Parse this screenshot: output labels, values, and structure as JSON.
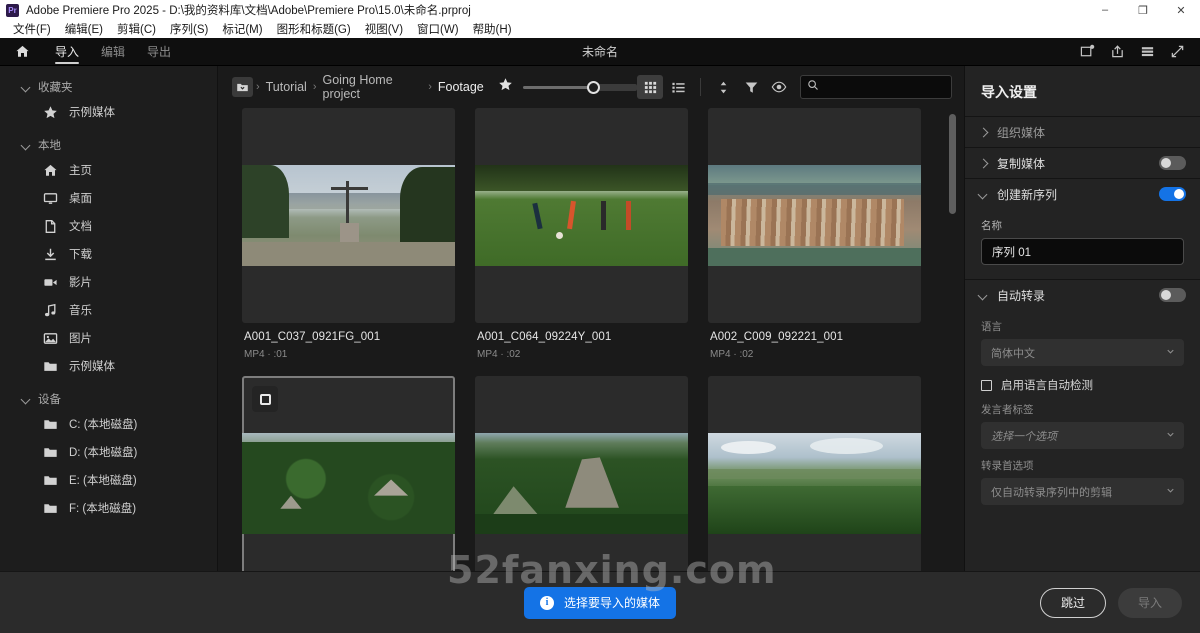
{
  "window": {
    "title": "Adobe Premiere Pro 2025 - D:\\我的资料库\\文档\\Adobe\\Premiere Pro\\15.0\\未命名.prproj",
    "logo": "Pr",
    "minimize": "–",
    "maximize": "❐",
    "close": "✕"
  },
  "menu": {
    "items": [
      {
        "label": "文件(F)"
      },
      {
        "label": "编辑(E)"
      },
      {
        "label": "剪辑(C)"
      },
      {
        "label": "序列(S)"
      },
      {
        "label": "标记(M)"
      },
      {
        "label": "图形和标题(G)"
      },
      {
        "label": "视图(V)"
      },
      {
        "label": "窗口(W)"
      },
      {
        "label": "帮助(H)"
      }
    ]
  },
  "appbar": {
    "home_icon": "home-icon",
    "tabs": [
      {
        "label": "导入",
        "active": true
      },
      {
        "label": "编辑",
        "active": false
      },
      {
        "label": "导出",
        "active": false
      }
    ],
    "doc_title": "未命名",
    "right_icons": [
      {
        "name": "new-project-icon"
      },
      {
        "name": "share-icon"
      },
      {
        "name": "menu-icon"
      },
      {
        "name": "fullscreen-icon"
      }
    ]
  },
  "sidebar": {
    "groups": [
      {
        "label": "收藏夹",
        "items": [
          {
            "label": "示例媒体",
            "icon": "star-icon"
          }
        ]
      },
      {
        "label": "本地",
        "items": [
          {
            "label": "主页",
            "icon": "home-icon"
          },
          {
            "label": "桌面",
            "icon": "monitor-icon"
          },
          {
            "label": "文档",
            "icon": "document-icon"
          },
          {
            "label": "下载",
            "icon": "download-icon"
          },
          {
            "label": "影片",
            "icon": "video-camera-icon"
          },
          {
            "label": "音乐",
            "icon": "music-note-icon"
          },
          {
            "label": "图片",
            "icon": "image-icon"
          },
          {
            "label": "示例媒体",
            "icon": "folder-icon"
          }
        ]
      },
      {
        "label": "设备",
        "items": [
          {
            "label": "C: (本地磁盘)",
            "icon": "folder-icon"
          },
          {
            "label": "D: (本地磁盘)",
            "icon": "folder-icon"
          },
          {
            "label": "E: (本地磁盘)",
            "icon": "folder-icon"
          },
          {
            "label": "F: (本地磁盘)",
            "icon": "folder-icon"
          }
        ]
      }
    ]
  },
  "mediabar": {
    "folder_icon": "folder-dropdown-icon",
    "breadcrumbs": [
      {
        "label": "Tutorial"
      },
      {
        "label": "Going Home project"
      },
      {
        "label": "Footage"
      }
    ],
    "separator": "›",
    "favorite_icon": "star-icon",
    "zoom_value": 62,
    "tools": [
      {
        "name": "grid-view-icon",
        "active": true
      },
      {
        "name": "list-view-icon",
        "active": false
      },
      {
        "name": "sort-icon",
        "active": false
      },
      {
        "name": "filter-icon",
        "active": false
      },
      {
        "name": "eye-icon",
        "active": false
      }
    ],
    "search": {
      "placeholder": "",
      "value": "",
      "icon": "search-icon"
    }
  },
  "media_items": [
    {
      "name": "A001_C037_0921FG_001",
      "meta": "MP4 · :01",
      "selected": false,
      "scene": "cross-hill"
    },
    {
      "name": "A001_C064_09224Y_001",
      "meta": "MP4 · :02",
      "selected": false,
      "scene": "soccer-field"
    },
    {
      "name": "A002_C009_092221_001",
      "meta": "MP4 · :02",
      "selected": false,
      "scene": "aerial-town"
    },
    {
      "name": "",
      "meta": "",
      "selected": true,
      "scene": "jungle-ruins-1"
    },
    {
      "name": "",
      "meta": "",
      "selected": false,
      "scene": "jungle-ruins-2"
    },
    {
      "name": "",
      "meta": "",
      "selected": false,
      "scene": "jungle-vista"
    }
  ],
  "import_settings": {
    "title": "导入设置",
    "sections": [
      {
        "label": "组织媒体",
        "expanded": false,
        "has_toggle": false,
        "toggle_on": false,
        "muted": true
      },
      {
        "label": "复制媒体",
        "expanded": false,
        "has_toggle": true,
        "toggle_on": false,
        "muted": false
      },
      {
        "label": "创建新序列",
        "expanded": true,
        "has_toggle": true,
        "toggle_on": true,
        "muted": false
      },
      {
        "label": "自动转录",
        "expanded": true,
        "has_toggle": true,
        "toggle_on": false,
        "muted": false
      }
    ],
    "sequence": {
      "name_label": "名称",
      "name_value": "序列 01"
    },
    "transcription": {
      "language_label": "语言",
      "language_value": "简体中文",
      "autodetect_label": "启用语言自动检测",
      "autodetect_checked": false,
      "speaker_label": "发言者标签",
      "speaker_placeholder": "选择一个选项",
      "prefs_label": "转录首选项",
      "prefs_value": "仅自动转录序列中的剪辑"
    }
  },
  "footer": {
    "notice": "选择要导入的媒体",
    "notice_icon": "info-icon",
    "skip_label": "跳过",
    "import_label": "导入"
  },
  "watermark": "52fanxing.com",
  "colors": {
    "accent": "#1473e6",
    "panel": "#232323",
    "sidebar": "#1d1d1d",
    "background": "#1a1a1a",
    "footer": "#2b2b2b"
  }
}
